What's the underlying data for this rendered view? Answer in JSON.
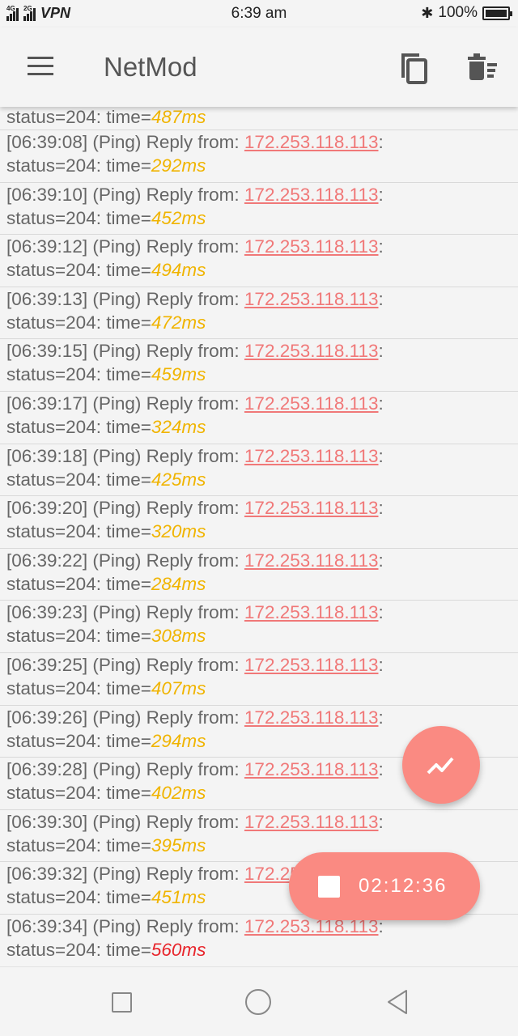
{
  "status_bar": {
    "signal1_label": "4G",
    "signal2_label": "2G",
    "vpn": "VPN",
    "time": "6:39 am",
    "bluetooth_icon": "bluetooth-icon",
    "battery_text": "100%",
    "battery_level": 1.0
  },
  "app_bar": {
    "title": "NetMod",
    "menu_icon": "hamburger-menu-icon",
    "copy_icon": "copy-icon",
    "delete_icon": "delete-sweep-icon"
  },
  "log": {
    "first_partial": {
      "status": "status=204: time=",
      "ms": "487ms"
    },
    "prefix": "(Ping) Reply from: ",
    "status_prefix": "status=204: time=",
    "entries": [
      {
        "time": "[06:39:08]",
        "ip": "172.253.118.113",
        "ms": "292ms"
      },
      {
        "time": "[06:39:10]",
        "ip": "172.253.118.113",
        "ms": "452ms"
      },
      {
        "time": "[06:39:12]",
        "ip": "172.253.118.113",
        "ms": "494ms"
      },
      {
        "time": "[06:39:13]",
        "ip": "172.253.118.113",
        "ms": "472ms"
      },
      {
        "time": "[06:39:15]",
        "ip": "172.253.118.113",
        "ms": "459ms"
      },
      {
        "time": "[06:39:17]",
        "ip": "172.253.118.113",
        "ms": "324ms"
      },
      {
        "time": "[06:39:18]",
        "ip": "172.253.118.113",
        "ms": "425ms"
      },
      {
        "time": "[06:39:20]",
        "ip": "172.253.118.113",
        "ms": "320ms"
      },
      {
        "time": "[06:39:22]",
        "ip": "172.253.118.113",
        "ms": "284ms"
      },
      {
        "time": "[06:39:23]",
        "ip": "172.253.118.113",
        "ms": "308ms"
      },
      {
        "time": "[06:39:25]",
        "ip": "172.253.118.113",
        "ms": "407ms"
      },
      {
        "time": "[06:39:26]",
        "ip": "172.253.118.113",
        "ms": "294ms"
      },
      {
        "time": "[06:39:28]",
        "ip": "172.253.118.113",
        "ms": "402ms"
      },
      {
        "time": "[06:39:30]",
        "ip": "172.253.118.113",
        "ms": "395ms"
      },
      {
        "time": "[06:39:32]",
        "ip": "172.253.118.113",
        "ms": "451ms"
      },
      {
        "time": "[06:39:34]",
        "ip": "172.253.118.113",
        "ms": "560ms",
        "bad": true
      }
    ],
    "colors": {
      "ip": "#f07878",
      "ms_ok": "#f0b400",
      "ms_bad": "#e8252b"
    }
  },
  "fab": {
    "graph_icon": "trending-chart-icon",
    "timer": "02:12:36",
    "stop_icon": "stop-icon",
    "color": "#fa8a82"
  },
  "nav_bar": {
    "recent_icon": "recent-apps-icon",
    "home_icon": "home-icon",
    "back_icon": "back-icon"
  }
}
